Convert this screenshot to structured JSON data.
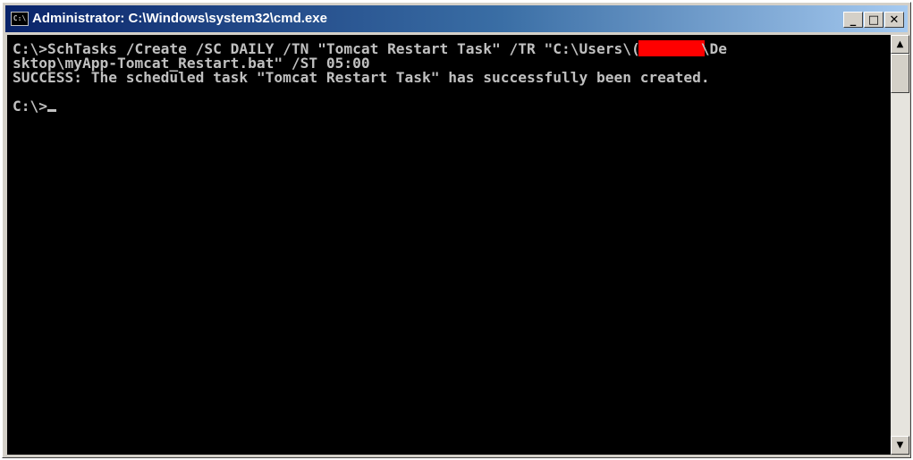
{
  "window": {
    "title": "Administrator: C:\\Windows\\system32\\cmd.exe",
    "icon": "cmd-icon",
    "buttons": {
      "minimize": "_",
      "maximize": "□",
      "close": "✕"
    }
  },
  "console": {
    "line1_before": "C:\\>SchTasks /Create /SC DAILY /TN \"Tomcat Restart Task\" /TR \"C:\\Users\\(",
    "line1_after": "\\De",
    "line2": "sktop\\myApp-Tomcat_Restart.bat\" /ST 05:00",
    "line3": "SUCCESS: The scheduled task \"Tomcat Restart Task\" has successfully been created.",
    "prompt": "C:\\>"
  },
  "colors": {
    "console_bg": "#000000",
    "console_fg": "#c0c0c0",
    "redaction": "#ff0000"
  },
  "scrollbar": {
    "up_arrow": "▲",
    "down_arrow": "▼"
  }
}
